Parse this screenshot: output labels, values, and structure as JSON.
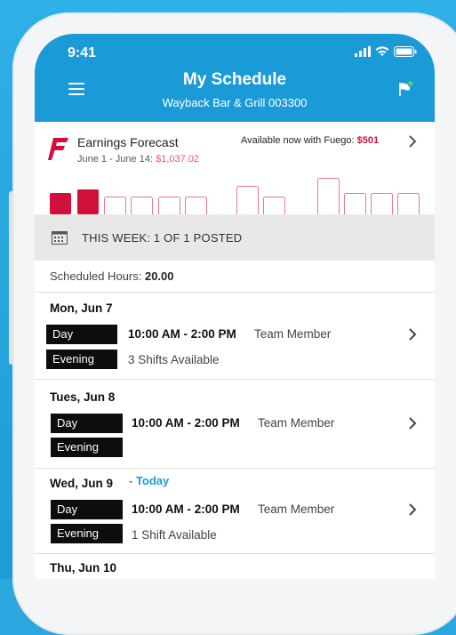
{
  "status": {
    "time": "9:41"
  },
  "header": {
    "title": "My Schedule",
    "subtitle": "Wayback Bar & Grill 003300"
  },
  "earnings": {
    "title": "Earnings Forecast",
    "range_label": "June 1 - June 14:",
    "range_amount": "$1,037.02",
    "available_label": "Available now with Fuego:",
    "available_amount": "$501"
  },
  "week": {
    "label": "THIS WEEK: 1 OF 1 POSTED"
  },
  "hours": {
    "label": "Scheduled Hours:",
    "value": "20.00"
  },
  "days": [
    {
      "name": "Mon, Jun 7",
      "pill1": "Day",
      "pill2": "Evening",
      "time": "10:00 AM - 2:00 PM",
      "role": "Team Member",
      "available": "3 Shifts Available"
    },
    {
      "name": "Tues, Jun 8",
      "pill1": "Day",
      "pill2": "Evening",
      "time": "10:00 AM - 2:00 PM",
      "role": "Team Member",
      "available": ""
    },
    {
      "name": "Wed, Jun 9",
      "today": "- Today",
      "pill1": "Day",
      "pill2": "Evening",
      "time": "10:00 AM - 2:00 PM",
      "role": "Team Member",
      "available": "1 Shift Available"
    },
    {
      "name": "Thu, Jun 10"
    }
  ],
  "colors": {
    "brand": "#1b9ad8",
    "accent_red": "#d0103a",
    "background": "#2aa7de"
  }
}
